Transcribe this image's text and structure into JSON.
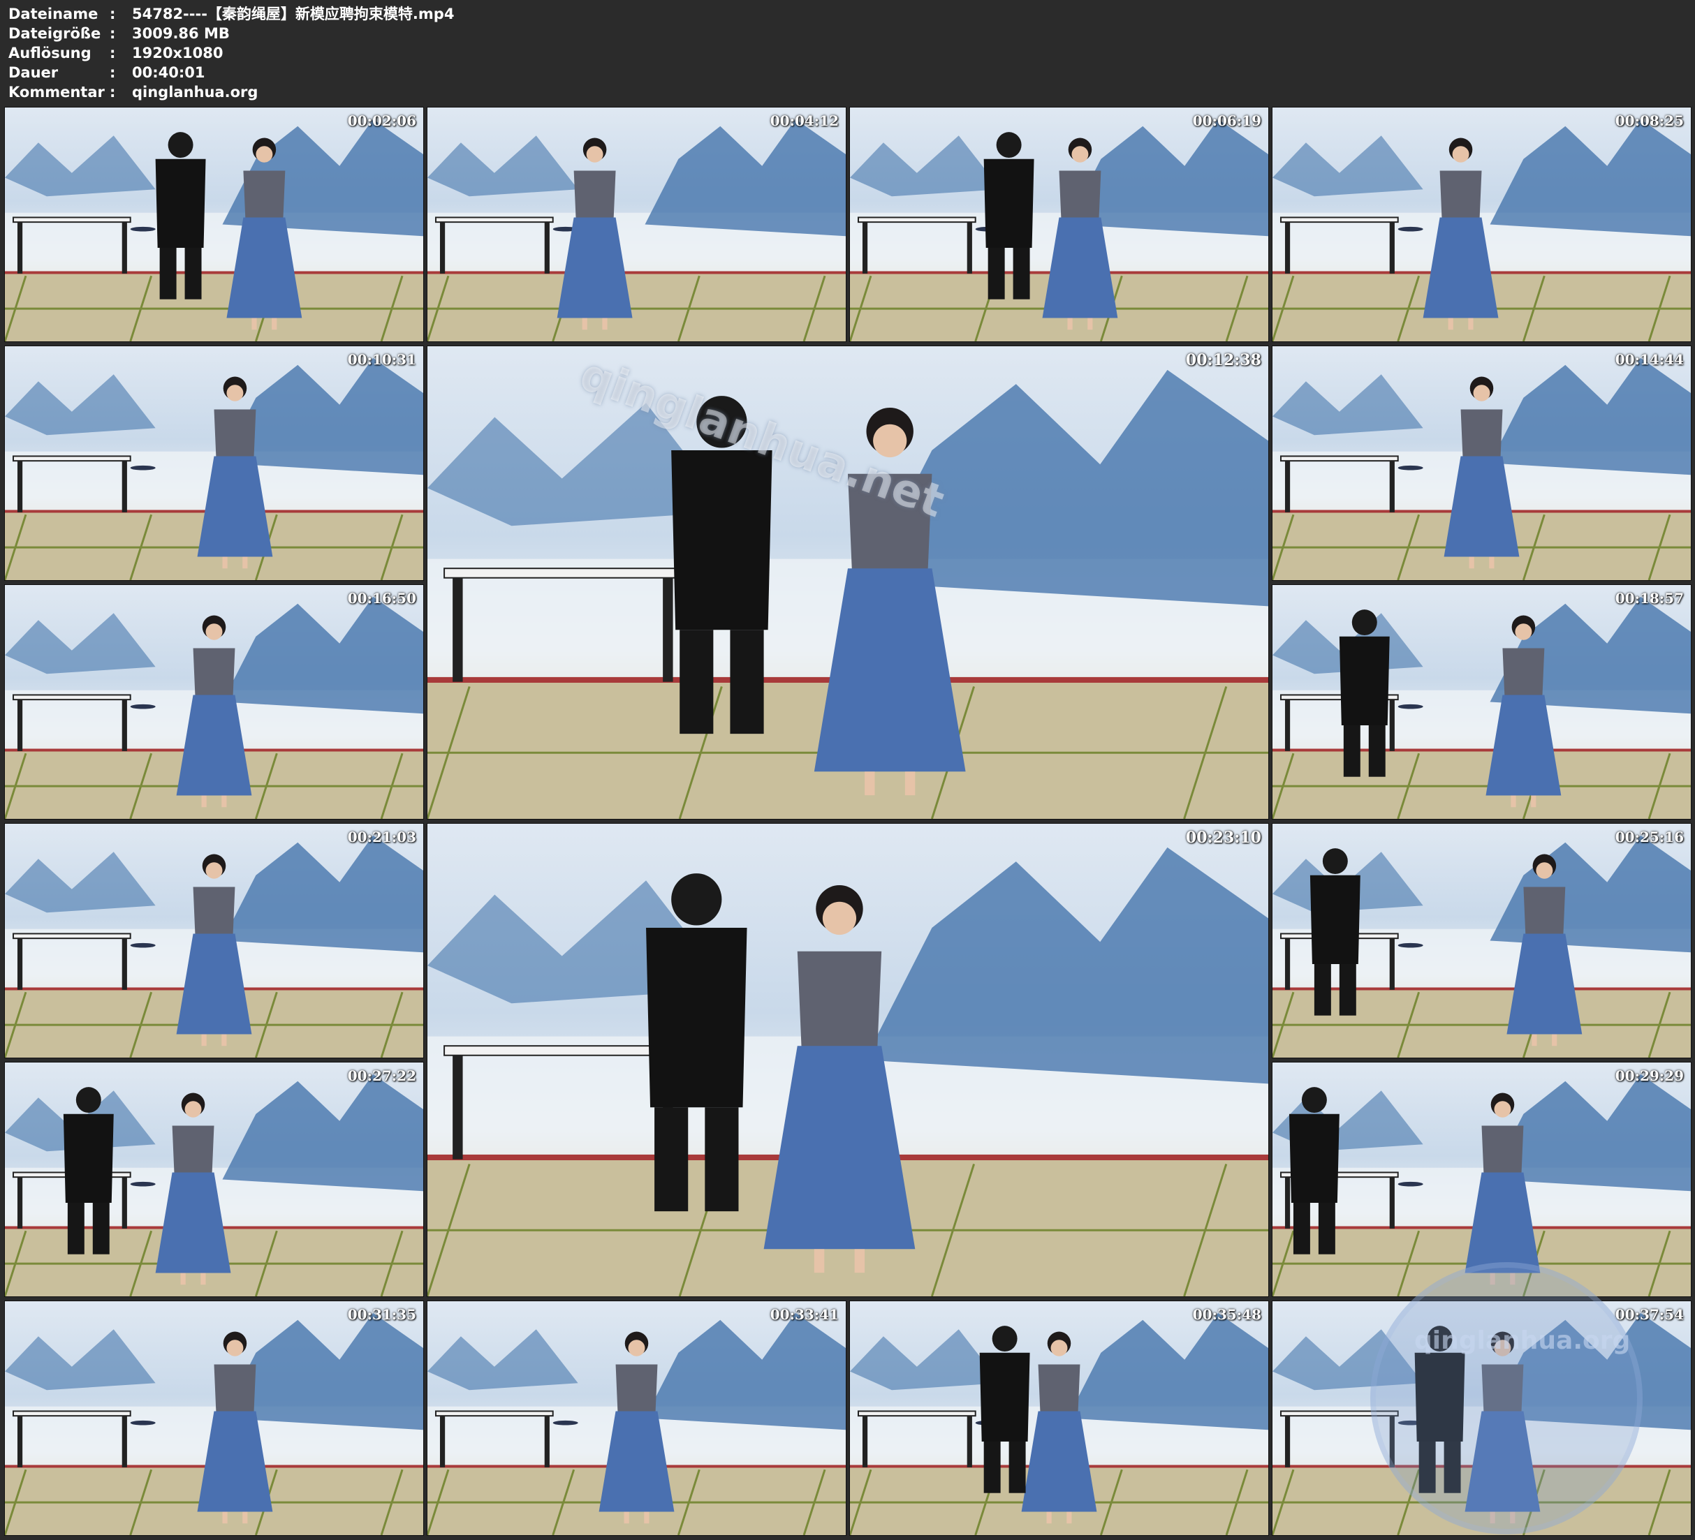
{
  "info": {
    "rows": [
      {
        "key": "Dateiname",
        "sep": ":",
        "value": "54782----【秦韵绳屋】新模应聘拘束模特.mp4"
      },
      {
        "key": "Dateigröße",
        "sep": ":",
        "value": "3009.86 MB"
      },
      {
        "key": "Auflösung",
        "sep": ":",
        "value": "1920x1080"
      },
      {
        "key": "Dauer",
        "sep": ":",
        "value": "00:40:01"
      },
      {
        "key": "Kommentar",
        "sep": ":",
        "value": "qinglanhua.org"
      }
    ]
  },
  "thumbnails": [
    {
      "time": "00:02:06"
    },
    {
      "time": "00:04:12"
    },
    {
      "time": "00:06:19"
    },
    {
      "time": "00:08:25"
    },
    {
      "time": "00:10:31"
    },
    {
      "time": "00:12:38"
    },
    {
      "time": "00:14:44"
    },
    {
      "time": "00:16:50"
    },
    {
      "time": "00:18:57"
    },
    {
      "time": "00:21:03"
    },
    {
      "time": "00:23:10"
    },
    {
      "time": "00:25:16"
    },
    {
      "time": "00:27:22"
    },
    {
      "time": "00:29:29"
    },
    {
      "time": "00:31:35"
    },
    {
      "time": "00:33:41"
    },
    {
      "time": "00:35:48"
    },
    {
      "time": "00:37:54"
    }
  ],
  "watermarks": {
    "frame_text": "qinglanhua.net",
    "seal_text": "qinglanhua.org"
  },
  "colors": {
    "background": "#2b2b2b",
    "mountain_blue": "#3d6fa8",
    "skirt_blue": "#4a70b0",
    "top_gray": "#5f6270",
    "floor_mat": "#c9bf9c"
  }
}
